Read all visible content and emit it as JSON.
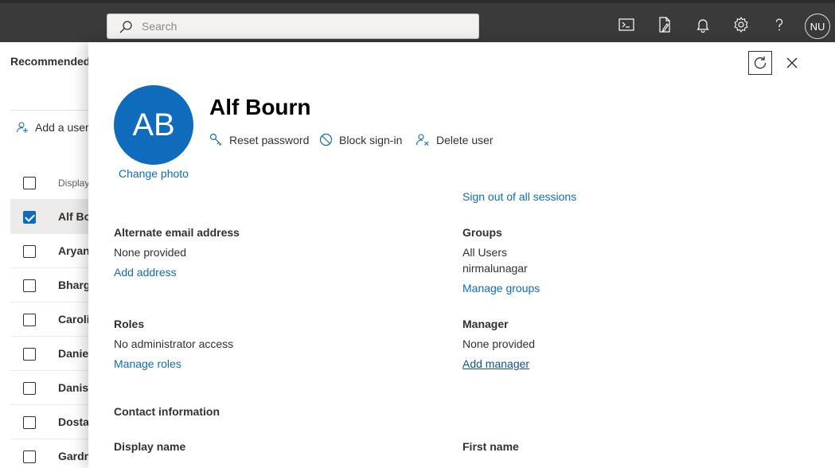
{
  "topbar": {
    "search_placeholder": "Search",
    "icons": [
      "cloud-shell-icon",
      "feedback-document-icon",
      "notifications-bell-icon",
      "settings-gear-icon",
      "help-question-icon"
    ],
    "account_initials": "NU"
  },
  "background": {
    "section_title": "Recommended",
    "add_user_label": "Add a user",
    "column_header": "Display",
    "rows": [
      {
        "label": "Alf Bo",
        "checked": true
      },
      {
        "label": "Aryan",
        "checked": false
      },
      {
        "label": "Bharg",
        "checked": false
      },
      {
        "label": "Caroli",
        "checked": false
      },
      {
        "label": "Daniel",
        "checked": false
      },
      {
        "label": "Danish",
        "checked": false
      },
      {
        "label": "Dostal",
        "checked": false
      },
      {
        "label": "Gardn",
        "checked": false
      }
    ]
  },
  "panel": {
    "avatar_initials": "AB",
    "change_photo": "Change photo",
    "user_name": "Alf Bourn",
    "actions": {
      "reset_password": "Reset password",
      "block_signin": "Block sign-in",
      "delete_user": "Delete user"
    },
    "sign_out": "Sign out of all sessions",
    "alternate_email": {
      "label": "Alternate email address",
      "value": "None provided",
      "link": "Add address"
    },
    "groups": {
      "label": "Groups",
      "values": [
        "All Users",
        "nirmalunagar"
      ],
      "link": "Manage groups"
    },
    "roles": {
      "label": "Roles",
      "value": "No administrator access",
      "link": "Manage roles"
    },
    "manager": {
      "label": "Manager",
      "value": "None provided",
      "link": "Add manager"
    },
    "contact_heading": "Contact information",
    "display_name_label": "Display name",
    "first_name_label": "First name"
  },
  "colors": {
    "accent": "#0f6cbd",
    "topbar": "#3a3a3a"
  }
}
